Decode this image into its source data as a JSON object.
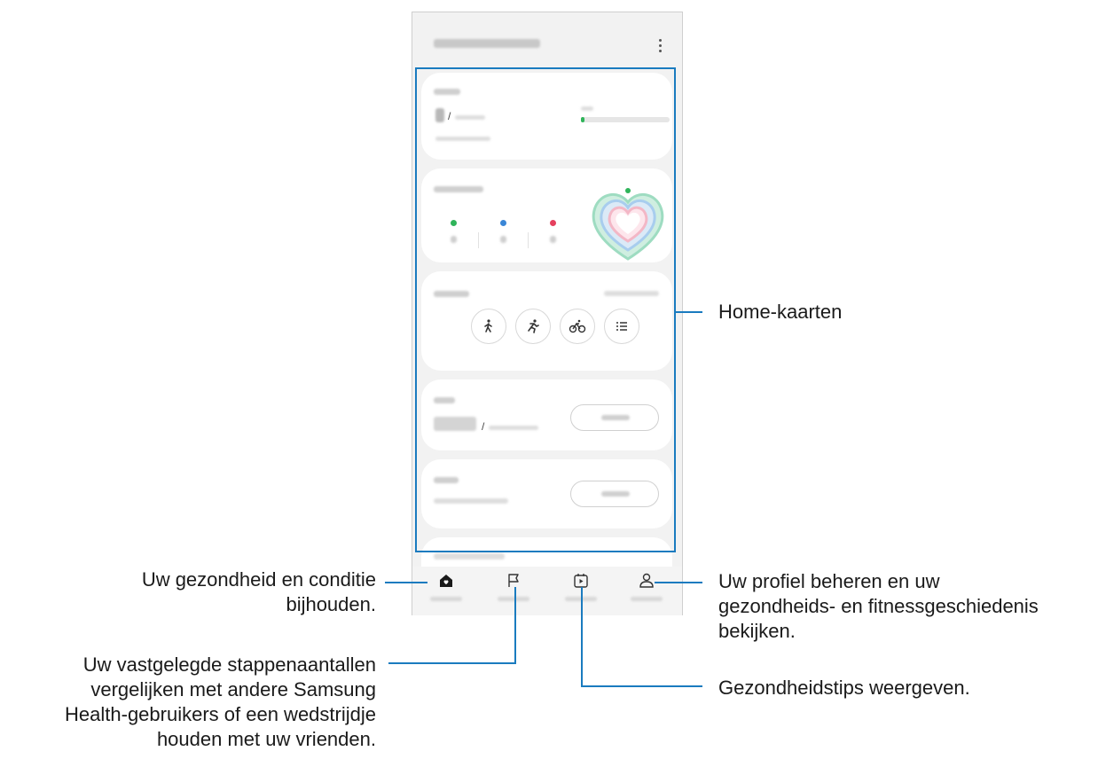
{
  "callouts": {
    "home_cards": "Home-kaarten",
    "home_tab": "Uw gezondheid en conditie\nbijhouden.",
    "together_tab": "Uw vastgelegde stappenaantallen\nvergelijken met andere Samsung\nHealth-gebruikers of een wedstrijdje\nhouden met uw vrienden.",
    "discover_tab": "Gezondheidstips weergeven.",
    "my_page_tab": "Uw profiel beheren en uw\ngezondheids- en fitnessgeschiedenis\nbekijken."
  },
  "steps_card": {
    "separator": "/",
    "progress": 0.03,
    "progress_color": "#2fb45a"
  },
  "daily_activity_card": {
    "metric_colors": [
      "#2fb45a",
      "#3a86d6",
      "#e5405e"
    ]
  },
  "exercise_card": {
    "icons": [
      "walking-icon",
      "running-icon",
      "cycling-icon",
      "list-icon"
    ]
  },
  "food_card": {
    "separator": "/"
  },
  "accent_color": "#1a7bbf"
}
